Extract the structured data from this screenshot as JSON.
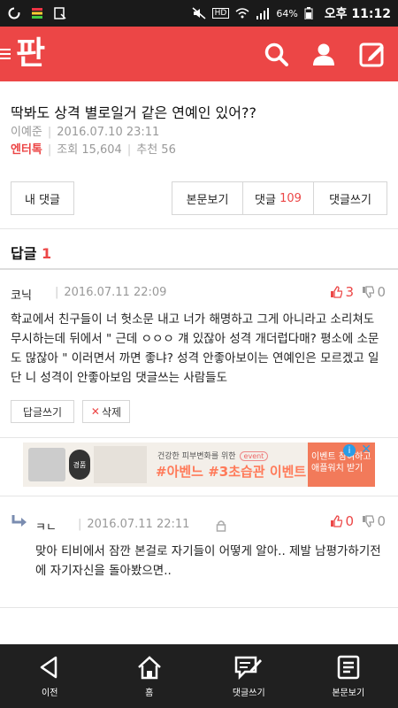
{
  "status_bar": {
    "time": "오후 11:12",
    "battery": "64%"
  },
  "app": {
    "logo": "판"
  },
  "post": {
    "title": "딱봐도 상격 별로일거 같은 연예인 있어??",
    "author": "이예준",
    "datetime": "2016.07.10 23:11",
    "category": "엔터톡",
    "views_label": "조회",
    "views": "15,604",
    "recommend_label": "추천",
    "recommend": "56"
  },
  "buttons": {
    "my_comments": "내 댓글",
    "view_body": "본문보기",
    "comments_label": "댓글",
    "comments_count": "109",
    "write_comment": "댓글쓰기"
  },
  "replies": {
    "label": "답글",
    "count": "1"
  },
  "comment": {
    "author": "코닉",
    "datetime": "2016.07.11 22:09",
    "likes": "3",
    "dislikes": "0",
    "body": "학교에서 친구들이 너 헛소문 내고 너가 해명하고 그게 아니라고 소리쳐도 무시하는데 뒤에서 \" 근데 ㅇㅇㅇ 걔 있잖아 성격 개더럽다매? 평소에 소문도 많잖아 \" 이러면서 까면 좋냐? 성격 안좋아보이는 연예인은 모르겠고 일단 니 성격이 안좋아보임 댓글쓰는 사람들도",
    "reply_button": "답글쓰기",
    "delete_button": "삭제"
  },
  "ad": {
    "badge": "경품",
    "subtitle": "건강한 피부변화를 위한",
    "pill": "event",
    "headline": "#아벤느 #3초습관 이벤트",
    "cta": "이벤트 참여하고 애플워치 받기"
  },
  "nested_comment": {
    "author": "ㅋㄴ",
    "datetime": "2016.07.11 22:11",
    "likes": "0",
    "dislikes": "0",
    "body": "맞아 티비에서 잠깐 본걸로 자기들이 어떻게 알아.. 제발 남평가하기전에 자기자신을 돌아봤으면.."
  },
  "bottom_nav": [
    {
      "label": "이전",
      "icon": "back-icon"
    },
    {
      "label": "홈",
      "icon": "home-icon"
    },
    {
      "label": "댓글쓰기",
      "icon": "write-comment-icon"
    },
    {
      "label": "본문보기",
      "icon": "document-icon"
    }
  ],
  "colors": {
    "brand": "#ec4646",
    "nav_bg": "#202020"
  }
}
